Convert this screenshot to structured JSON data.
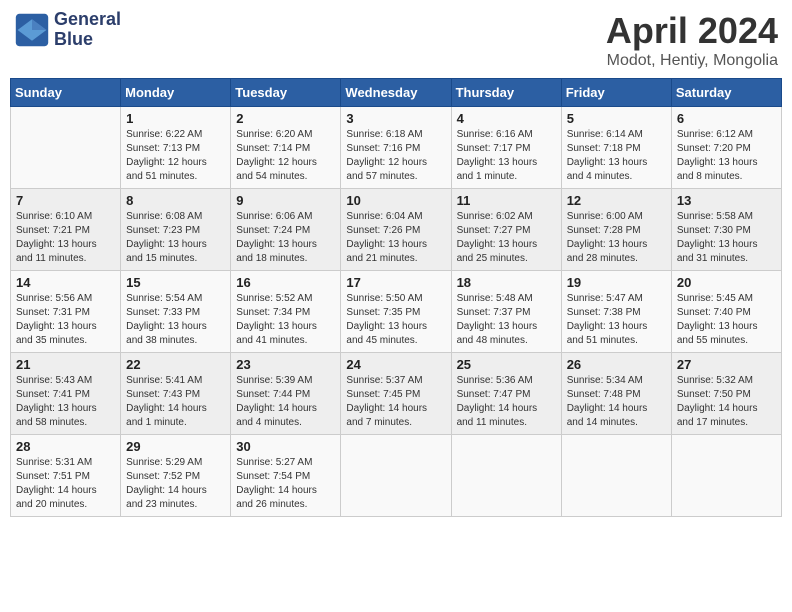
{
  "header": {
    "logo_line1": "General",
    "logo_line2": "Blue",
    "title": "April 2024",
    "subtitle": "Modot, Hentiy, Mongolia"
  },
  "days_of_week": [
    "Sunday",
    "Monday",
    "Tuesday",
    "Wednesday",
    "Thursday",
    "Friday",
    "Saturday"
  ],
  "weeks": [
    [
      {
        "day": "",
        "info": ""
      },
      {
        "day": "1",
        "info": "Sunrise: 6:22 AM\nSunset: 7:13 PM\nDaylight: 12 hours\nand 51 minutes."
      },
      {
        "day": "2",
        "info": "Sunrise: 6:20 AM\nSunset: 7:14 PM\nDaylight: 12 hours\nand 54 minutes."
      },
      {
        "day": "3",
        "info": "Sunrise: 6:18 AM\nSunset: 7:16 PM\nDaylight: 12 hours\nand 57 minutes."
      },
      {
        "day": "4",
        "info": "Sunrise: 6:16 AM\nSunset: 7:17 PM\nDaylight: 13 hours\nand 1 minute."
      },
      {
        "day": "5",
        "info": "Sunrise: 6:14 AM\nSunset: 7:18 PM\nDaylight: 13 hours\nand 4 minutes."
      },
      {
        "day": "6",
        "info": "Sunrise: 6:12 AM\nSunset: 7:20 PM\nDaylight: 13 hours\nand 8 minutes."
      }
    ],
    [
      {
        "day": "7",
        "info": "Sunrise: 6:10 AM\nSunset: 7:21 PM\nDaylight: 13 hours\nand 11 minutes."
      },
      {
        "day": "8",
        "info": "Sunrise: 6:08 AM\nSunset: 7:23 PM\nDaylight: 13 hours\nand 15 minutes."
      },
      {
        "day": "9",
        "info": "Sunrise: 6:06 AM\nSunset: 7:24 PM\nDaylight: 13 hours\nand 18 minutes."
      },
      {
        "day": "10",
        "info": "Sunrise: 6:04 AM\nSunset: 7:26 PM\nDaylight: 13 hours\nand 21 minutes."
      },
      {
        "day": "11",
        "info": "Sunrise: 6:02 AM\nSunset: 7:27 PM\nDaylight: 13 hours\nand 25 minutes."
      },
      {
        "day": "12",
        "info": "Sunrise: 6:00 AM\nSunset: 7:28 PM\nDaylight: 13 hours\nand 28 minutes."
      },
      {
        "day": "13",
        "info": "Sunrise: 5:58 AM\nSunset: 7:30 PM\nDaylight: 13 hours\nand 31 minutes."
      }
    ],
    [
      {
        "day": "14",
        "info": "Sunrise: 5:56 AM\nSunset: 7:31 PM\nDaylight: 13 hours\nand 35 minutes."
      },
      {
        "day": "15",
        "info": "Sunrise: 5:54 AM\nSunset: 7:33 PM\nDaylight: 13 hours\nand 38 minutes."
      },
      {
        "day": "16",
        "info": "Sunrise: 5:52 AM\nSunset: 7:34 PM\nDaylight: 13 hours\nand 41 minutes."
      },
      {
        "day": "17",
        "info": "Sunrise: 5:50 AM\nSunset: 7:35 PM\nDaylight: 13 hours\nand 45 minutes."
      },
      {
        "day": "18",
        "info": "Sunrise: 5:48 AM\nSunset: 7:37 PM\nDaylight: 13 hours\nand 48 minutes."
      },
      {
        "day": "19",
        "info": "Sunrise: 5:47 AM\nSunset: 7:38 PM\nDaylight: 13 hours\nand 51 minutes."
      },
      {
        "day": "20",
        "info": "Sunrise: 5:45 AM\nSunset: 7:40 PM\nDaylight: 13 hours\nand 55 minutes."
      }
    ],
    [
      {
        "day": "21",
        "info": "Sunrise: 5:43 AM\nSunset: 7:41 PM\nDaylight: 13 hours\nand 58 minutes."
      },
      {
        "day": "22",
        "info": "Sunrise: 5:41 AM\nSunset: 7:43 PM\nDaylight: 14 hours\nand 1 minute."
      },
      {
        "day": "23",
        "info": "Sunrise: 5:39 AM\nSunset: 7:44 PM\nDaylight: 14 hours\nand 4 minutes."
      },
      {
        "day": "24",
        "info": "Sunrise: 5:37 AM\nSunset: 7:45 PM\nDaylight: 14 hours\nand 7 minutes."
      },
      {
        "day": "25",
        "info": "Sunrise: 5:36 AM\nSunset: 7:47 PM\nDaylight: 14 hours\nand 11 minutes."
      },
      {
        "day": "26",
        "info": "Sunrise: 5:34 AM\nSunset: 7:48 PM\nDaylight: 14 hours\nand 14 minutes."
      },
      {
        "day": "27",
        "info": "Sunrise: 5:32 AM\nSunset: 7:50 PM\nDaylight: 14 hours\nand 17 minutes."
      }
    ],
    [
      {
        "day": "28",
        "info": "Sunrise: 5:31 AM\nSunset: 7:51 PM\nDaylight: 14 hours\nand 20 minutes."
      },
      {
        "day": "29",
        "info": "Sunrise: 5:29 AM\nSunset: 7:52 PM\nDaylight: 14 hours\nand 23 minutes."
      },
      {
        "day": "30",
        "info": "Sunrise: 5:27 AM\nSunset: 7:54 PM\nDaylight: 14 hours\nand 26 minutes."
      },
      {
        "day": "",
        "info": ""
      },
      {
        "day": "",
        "info": ""
      },
      {
        "day": "",
        "info": ""
      },
      {
        "day": "",
        "info": ""
      }
    ]
  ]
}
